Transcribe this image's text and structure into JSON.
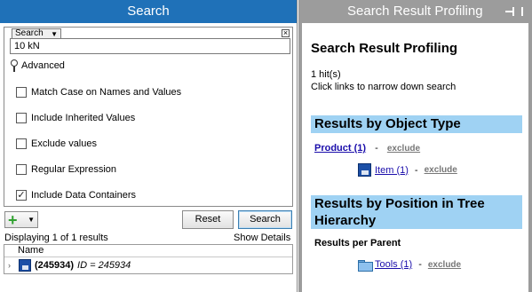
{
  "left_panel": {
    "title": "Search",
    "search_mode": "Search",
    "clear_icon": "close-icon",
    "query_value": "10 kN",
    "advanced_label": "Advanced",
    "options": [
      {
        "label": "Match Case on Names and Values",
        "checked": false
      },
      {
        "label": "Include Inherited Values",
        "checked": false
      },
      {
        "label": "Exclude values",
        "checked": false
      },
      {
        "label": "Regular Expression",
        "checked": false
      },
      {
        "label": "Include Data Containers",
        "checked": true
      }
    ],
    "add_icon": "plus-icon",
    "reset_label": "Reset",
    "search_label": "Search",
    "status_text": "Displaying 1 of 1 results",
    "show_details_label": "Show Details",
    "results_column": "Name",
    "result_row": {
      "id": "(245934)",
      "expr": "ID = 245934"
    }
  },
  "right_panel": {
    "title": "Search Result Profiling",
    "pin_icon": "pin-icon",
    "heading": "Search Result Profiling",
    "hits": "1 hit(s)",
    "hint": "Click links to narrow down search",
    "section_type": "Results by Object Type",
    "product_link": "Product (1)",
    "product_exclude": "exclude",
    "item_link": "Item (1)",
    "item_exclude": "exclude",
    "section_position": "Results by Position in Tree Hierarchy",
    "results_per_parent": "Results per Parent",
    "tools_link": "Tools (1)",
    "tools_exclude": "exclude",
    "dash": "-"
  },
  "colors": {
    "title_bar": "#1f71b8",
    "band": "#9fd2f3",
    "right_frame": "#9c9c9c"
  }
}
